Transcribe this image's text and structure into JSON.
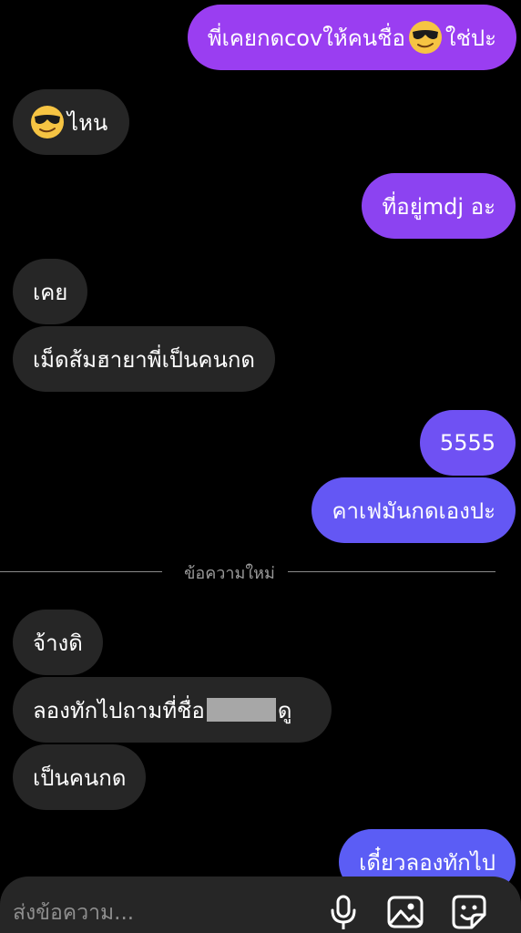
{
  "messages": [
    {
      "side": "out",
      "text_before": "พี่เคยกดcovให้คนชื่อ",
      "emoji": "sunglasses-face",
      "text_after": "ใช่ปะ"
    },
    {
      "side": "in",
      "emoji": "sunglasses-face",
      "text_after": "ไหน"
    },
    {
      "side": "out",
      "text": "ที่อยู่mdj อะ"
    },
    {
      "side": "in",
      "text": "เคย"
    },
    {
      "side": "in",
      "text": "เม็ดส้มฮายาพี่เป็นคนกด"
    },
    {
      "side": "out",
      "text": "5555"
    },
    {
      "side": "out",
      "text": "คาเฟมันกดเองปะ"
    },
    {
      "side": "in",
      "text": "จ้างดิ"
    },
    {
      "side": "in",
      "text_before": "ลองทักไปถามที่ชื่อ",
      "redacted": true,
      "text_after": "ดู"
    },
    {
      "side": "in",
      "text": "เป็นคนกด"
    },
    {
      "side": "out",
      "text": "เดี๋ยวลองทักไป"
    }
  ],
  "divider_label": "ข้อความใหม่",
  "composer": {
    "placeholder": "ส่งข้อความ...",
    "icons": [
      "microphone-icon",
      "gallery-icon",
      "sticker-icon"
    ]
  },
  "colors": {
    "background": "#000000",
    "incoming_bubble": "#262626",
    "outgoing_top": "#9b3cf0",
    "outgoing_bottom": "#5b5df5",
    "divider_text": "#9b9b9b"
  }
}
